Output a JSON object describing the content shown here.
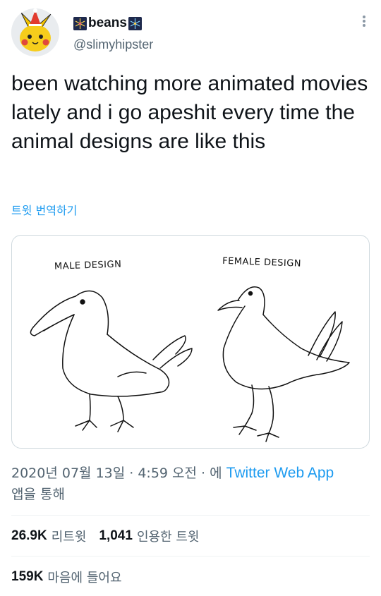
{
  "user": {
    "display_name": "beans",
    "handle": "@slimyhipster",
    "avatar_icon": "pikachu-party-hat-avatar",
    "name_emoji_icon": "fireworks-icon"
  },
  "tweet": {
    "text": "been watching more animated movies lately and i go apeshit every time the animal designs are like this",
    "translate_label": "트윗 번역하기"
  },
  "media": {
    "left_caption": "MALE DESIGN",
    "right_caption": "FEMALE DESIGN"
  },
  "meta": {
    "timestamp": "2020년 07월 13일 · 4:59 오전 · 에 ",
    "source": "Twitter Web App",
    "source_suffix": "앱을 통해"
  },
  "stats": {
    "retweets_count": "26.9K",
    "retweets_label": "리트윗",
    "quotes_count": "1,041",
    "quotes_label": "인용한 트윗",
    "likes_count": "159K",
    "likes_label": "마음에 들어요"
  },
  "colors": {
    "link": "#1d9bf0",
    "secondary_text": "#536471",
    "primary_text": "#0f1419"
  }
}
